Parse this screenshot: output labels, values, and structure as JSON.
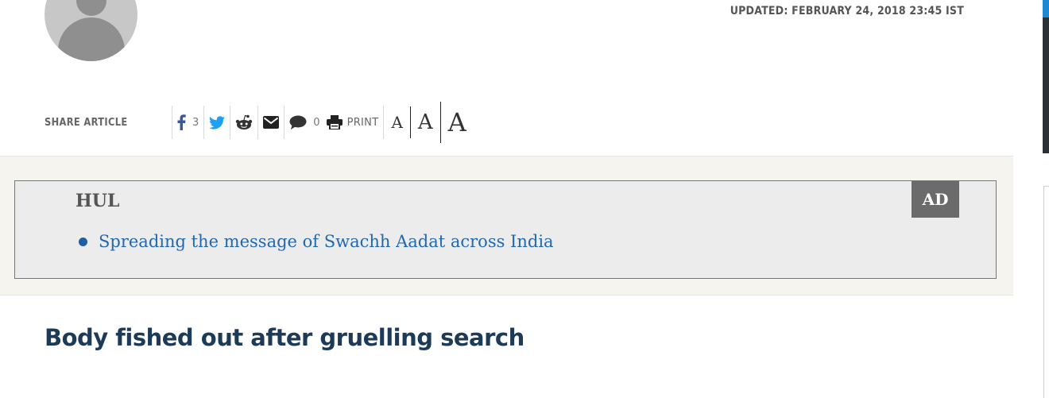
{
  "article": {
    "updated": "UPDATED: FEBRUARY 24, 2018 23:45 IST",
    "headline": "Body fished out after gruelling search"
  },
  "share": {
    "label": "SHARE ARTICLE",
    "facebook_icon": "facebook-icon",
    "facebook_count": "3",
    "twitter_icon": "twitter-icon",
    "reddit_icon": "reddit-icon",
    "email_icon": "email-icon",
    "comment_icon": "comment-icon",
    "comment_count": "0",
    "print_icon": "print-icon",
    "print_label": "PRINT",
    "font_sizes": [
      "A",
      "A",
      "A"
    ]
  },
  "ad": {
    "brand": "HUL",
    "badge": "AD",
    "link_text": "Spreading the message of Swachh Aadat across India"
  },
  "colors": {
    "headline": "#1d3a57",
    "link": "#2268ad",
    "facebook": "#3b5998",
    "twitter": "#1da1f2",
    "icon_dark": "#222222"
  }
}
